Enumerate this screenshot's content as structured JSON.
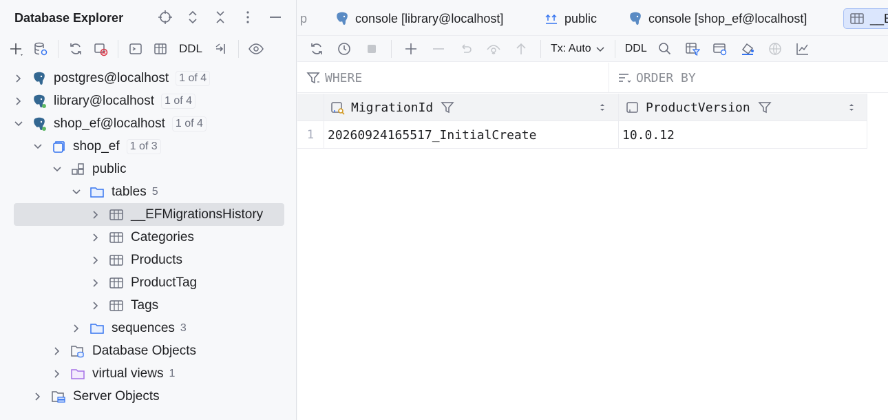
{
  "explorer": {
    "title": "Database Explorer",
    "toolbar": {
      "ddl_label": "DDL"
    },
    "tree": [
      {
        "label": "postgres@localhost",
        "badge": "1 of 4"
      },
      {
        "label": "library@localhost",
        "badge": "1 of 4"
      },
      {
        "label": "shop_ef@localhost",
        "badge": "1 of 4"
      },
      {
        "label": "shop_ef",
        "badge": "1 of 3"
      },
      {
        "label": "public"
      },
      {
        "label": "tables",
        "count": "5"
      },
      {
        "label": "__EFMigrationsHistory"
      },
      {
        "label": "Categories"
      },
      {
        "label": "Products"
      },
      {
        "label": "ProductTag"
      },
      {
        "label": "Tags"
      },
      {
        "label": "sequences",
        "count": "3"
      },
      {
        "label": "Database Objects"
      },
      {
        "label": "virtual views",
        "count": "1"
      },
      {
        "label": "Server Objects"
      }
    ]
  },
  "tabs": [
    {
      "label": "p"
    },
    {
      "label": "console [library@localhost]"
    },
    {
      "label": "public"
    },
    {
      "label": "console [shop_ef@localhost]"
    },
    {
      "label": "__E"
    }
  ],
  "editor_toolbar": {
    "tx_label": "Tx: Auto",
    "ddl_label": "DDL"
  },
  "filters": {
    "where": "WHERE",
    "order_by": "ORDER BY"
  },
  "grid": {
    "columns": [
      "MigrationId",
      "ProductVersion"
    ],
    "rows": [
      {
        "num": "1",
        "cells": [
          "20260924165517_InitialCreate",
          "10.0.12"
        ]
      }
    ]
  },
  "colors": {
    "accent": "#3574f0",
    "selection": "#dfe1e5",
    "postgres_blue": "#336791",
    "online_green": "#5fb865"
  }
}
